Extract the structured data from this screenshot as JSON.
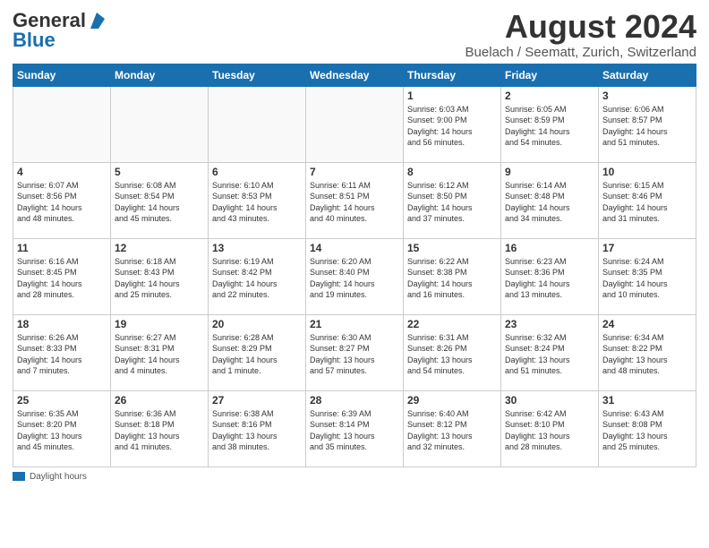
{
  "header": {
    "logo_general": "General",
    "logo_blue": "Blue",
    "month_title": "August 2024",
    "location": "Buelach / Seematt, Zurich, Switzerland"
  },
  "days_of_week": [
    "Sunday",
    "Monday",
    "Tuesday",
    "Wednesday",
    "Thursday",
    "Friday",
    "Saturday"
  ],
  "weeks": [
    [
      {
        "day": "",
        "info": ""
      },
      {
        "day": "",
        "info": ""
      },
      {
        "day": "",
        "info": ""
      },
      {
        "day": "",
        "info": ""
      },
      {
        "day": "1",
        "info": "Sunrise: 6:03 AM\nSunset: 9:00 PM\nDaylight: 14 hours\nand 56 minutes."
      },
      {
        "day": "2",
        "info": "Sunrise: 6:05 AM\nSunset: 8:59 PM\nDaylight: 14 hours\nand 54 minutes."
      },
      {
        "day": "3",
        "info": "Sunrise: 6:06 AM\nSunset: 8:57 PM\nDaylight: 14 hours\nand 51 minutes."
      }
    ],
    [
      {
        "day": "4",
        "info": "Sunrise: 6:07 AM\nSunset: 8:56 PM\nDaylight: 14 hours\nand 48 minutes."
      },
      {
        "day": "5",
        "info": "Sunrise: 6:08 AM\nSunset: 8:54 PM\nDaylight: 14 hours\nand 45 minutes."
      },
      {
        "day": "6",
        "info": "Sunrise: 6:10 AM\nSunset: 8:53 PM\nDaylight: 14 hours\nand 43 minutes."
      },
      {
        "day": "7",
        "info": "Sunrise: 6:11 AM\nSunset: 8:51 PM\nDaylight: 14 hours\nand 40 minutes."
      },
      {
        "day": "8",
        "info": "Sunrise: 6:12 AM\nSunset: 8:50 PM\nDaylight: 14 hours\nand 37 minutes."
      },
      {
        "day": "9",
        "info": "Sunrise: 6:14 AM\nSunset: 8:48 PM\nDaylight: 14 hours\nand 34 minutes."
      },
      {
        "day": "10",
        "info": "Sunrise: 6:15 AM\nSunset: 8:46 PM\nDaylight: 14 hours\nand 31 minutes."
      }
    ],
    [
      {
        "day": "11",
        "info": "Sunrise: 6:16 AM\nSunset: 8:45 PM\nDaylight: 14 hours\nand 28 minutes."
      },
      {
        "day": "12",
        "info": "Sunrise: 6:18 AM\nSunset: 8:43 PM\nDaylight: 14 hours\nand 25 minutes."
      },
      {
        "day": "13",
        "info": "Sunrise: 6:19 AM\nSunset: 8:42 PM\nDaylight: 14 hours\nand 22 minutes."
      },
      {
        "day": "14",
        "info": "Sunrise: 6:20 AM\nSunset: 8:40 PM\nDaylight: 14 hours\nand 19 minutes."
      },
      {
        "day": "15",
        "info": "Sunrise: 6:22 AM\nSunset: 8:38 PM\nDaylight: 14 hours\nand 16 minutes."
      },
      {
        "day": "16",
        "info": "Sunrise: 6:23 AM\nSunset: 8:36 PM\nDaylight: 14 hours\nand 13 minutes."
      },
      {
        "day": "17",
        "info": "Sunrise: 6:24 AM\nSunset: 8:35 PM\nDaylight: 14 hours\nand 10 minutes."
      }
    ],
    [
      {
        "day": "18",
        "info": "Sunrise: 6:26 AM\nSunset: 8:33 PM\nDaylight: 14 hours\nand 7 minutes."
      },
      {
        "day": "19",
        "info": "Sunrise: 6:27 AM\nSunset: 8:31 PM\nDaylight: 14 hours\nand 4 minutes."
      },
      {
        "day": "20",
        "info": "Sunrise: 6:28 AM\nSunset: 8:29 PM\nDaylight: 14 hours\nand 1 minute."
      },
      {
        "day": "21",
        "info": "Sunrise: 6:30 AM\nSunset: 8:27 PM\nDaylight: 13 hours\nand 57 minutes."
      },
      {
        "day": "22",
        "info": "Sunrise: 6:31 AM\nSunset: 8:26 PM\nDaylight: 13 hours\nand 54 minutes."
      },
      {
        "day": "23",
        "info": "Sunrise: 6:32 AM\nSunset: 8:24 PM\nDaylight: 13 hours\nand 51 minutes."
      },
      {
        "day": "24",
        "info": "Sunrise: 6:34 AM\nSunset: 8:22 PM\nDaylight: 13 hours\nand 48 minutes."
      }
    ],
    [
      {
        "day": "25",
        "info": "Sunrise: 6:35 AM\nSunset: 8:20 PM\nDaylight: 13 hours\nand 45 minutes."
      },
      {
        "day": "26",
        "info": "Sunrise: 6:36 AM\nSunset: 8:18 PM\nDaylight: 13 hours\nand 41 minutes."
      },
      {
        "day": "27",
        "info": "Sunrise: 6:38 AM\nSunset: 8:16 PM\nDaylight: 13 hours\nand 38 minutes."
      },
      {
        "day": "28",
        "info": "Sunrise: 6:39 AM\nSunset: 8:14 PM\nDaylight: 13 hours\nand 35 minutes."
      },
      {
        "day": "29",
        "info": "Sunrise: 6:40 AM\nSunset: 8:12 PM\nDaylight: 13 hours\nand 32 minutes."
      },
      {
        "day": "30",
        "info": "Sunrise: 6:42 AM\nSunset: 8:10 PM\nDaylight: 13 hours\nand 28 minutes."
      },
      {
        "day": "31",
        "info": "Sunrise: 6:43 AM\nSunset: 8:08 PM\nDaylight: 13 hours\nand 25 minutes."
      }
    ]
  ],
  "legend": {
    "color_label": "Daylight hours"
  }
}
